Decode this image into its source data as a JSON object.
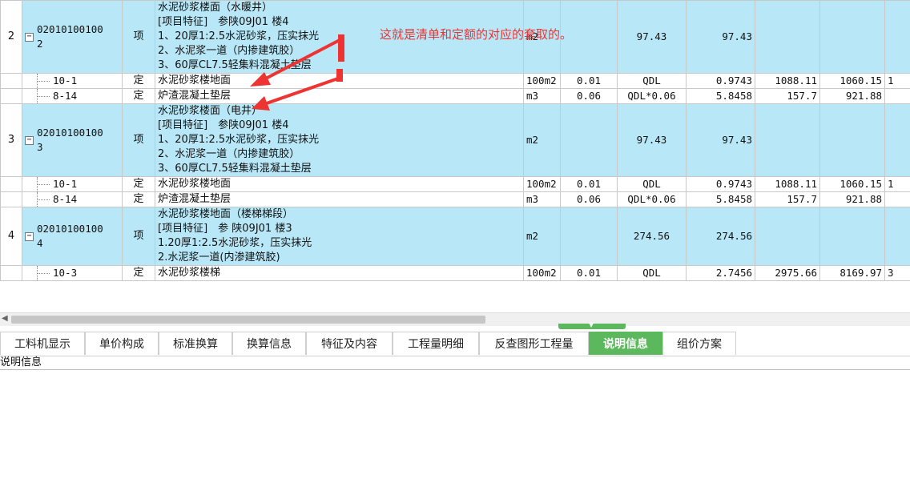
{
  "rows": [
    {
      "type": "qd",
      "no": "2",
      "code": "020101001002",
      "kind": "项",
      "name": [
        "水泥砂浆楼面（水暖井）",
        "[项目特征]　参陕09J01 楼4",
        "1、20厚1:2.5水泥砂浆，压实抹光",
        "2、水泥浆一道（内掺建筑胶）",
        "3、60厚CL7.5轻集料混凝土垫层"
      ],
      "unit": "m2",
      "coef": "",
      "expr": "97.43",
      "qty": "97.43",
      "c9": "",
      "c10": "",
      "c11": ""
    },
    {
      "type": "de",
      "code": "10-1",
      "kind": "定",
      "name": "水泥砂浆楼地面",
      "unit": "100m2",
      "coef": "0.01",
      "expr": "QDL",
      "qty": "0.9743",
      "c9": "1088.11",
      "c10": "1060.15",
      "c11": "1"
    },
    {
      "type": "de",
      "code": "8-14",
      "kind": "定",
      "name": "炉渣混凝土垫层",
      "unit": "m3",
      "coef": "0.06",
      "expr": "QDL*0.06",
      "qty": "5.8458",
      "c9": "157.7",
      "c10": "921.88",
      "c11": ""
    },
    {
      "type": "qd",
      "no": "3",
      "code": "020101001003",
      "kind": "项",
      "name": [
        "水泥砂浆楼面（电井）",
        "[项目特征]　参陕09J01 楼4",
        "1、20厚1:2.5水泥砂浆，压实抹光",
        "2、水泥浆一道（内掺建筑胶）",
        "3、60厚CL7.5轻集料混凝土垫层"
      ],
      "unit": "m2",
      "coef": "",
      "expr": "97.43",
      "qty": "97.43",
      "c9": "",
      "c10": "",
      "c11": ""
    },
    {
      "type": "de",
      "code": "10-1",
      "kind": "定",
      "name": "水泥砂浆楼地面",
      "unit": "100m2",
      "coef": "0.01",
      "expr": "QDL",
      "qty": "0.9743",
      "c9": "1088.11",
      "c10": "1060.15",
      "c11": "1"
    },
    {
      "type": "de",
      "code": "8-14",
      "kind": "定",
      "name": "炉渣混凝土垫层",
      "unit": "m3",
      "coef": "0.06",
      "expr": "QDL*0.06",
      "qty": "5.8458",
      "c9": "157.7",
      "c10": "921.88",
      "c11": ""
    },
    {
      "type": "qd",
      "no": "4",
      "code": "020101001004",
      "kind": "项",
      "name": [
        "水泥砂浆楼地面（楼梯梯段）",
        "[项目特征]　参 陕09J01 楼3",
        "1.20厚1:2.5水泥砂浆，压实抹光",
        "2.水泥浆一道(内渗建筑胶)"
      ],
      "unit": "m2",
      "coef": "",
      "expr": "274.56",
      "qty": "274.56",
      "c9": "",
      "c10": "",
      "c11": ""
    },
    {
      "type": "de",
      "code": "10-3",
      "kind": "定",
      "name": "水泥砂浆楼梯",
      "unit": "100m2",
      "coef": "0.01",
      "expr": "QDL",
      "qty": "2.7456",
      "c9": "2975.66",
      "c10": "8169.97",
      "c11": "3"
    }
  ],
  "annotation": "这就是清单和定额的对应的套取的。",
  "tabs": [
    {
      "label": "工料机显示",
      "active": false
    },
    {
      "label": "单价构成",
      "active": false
    },
    {
      "label": "标准换算",
      "active": false
    },
    {
      "label": "换算信息",
      "active": false
    },
    {
      "label": "特征及内容",
      "active": false
    },
    {
      "label": "工程量明细",
      "active": false
    },
    {
      "label": "反查图形工程量",
      "active": false
    },
    {
      "label": "说明信息",
      "active": true
    },
    {
      "label": "组价方案",
      "active": false
    }
  ],
  "description_header": "说明信息",
  "colors": {
    "row_highlight": "#b8e8f8",
    "tab_active": "#5cb85c",
    "annotation": "#ee3333"
  }
}
